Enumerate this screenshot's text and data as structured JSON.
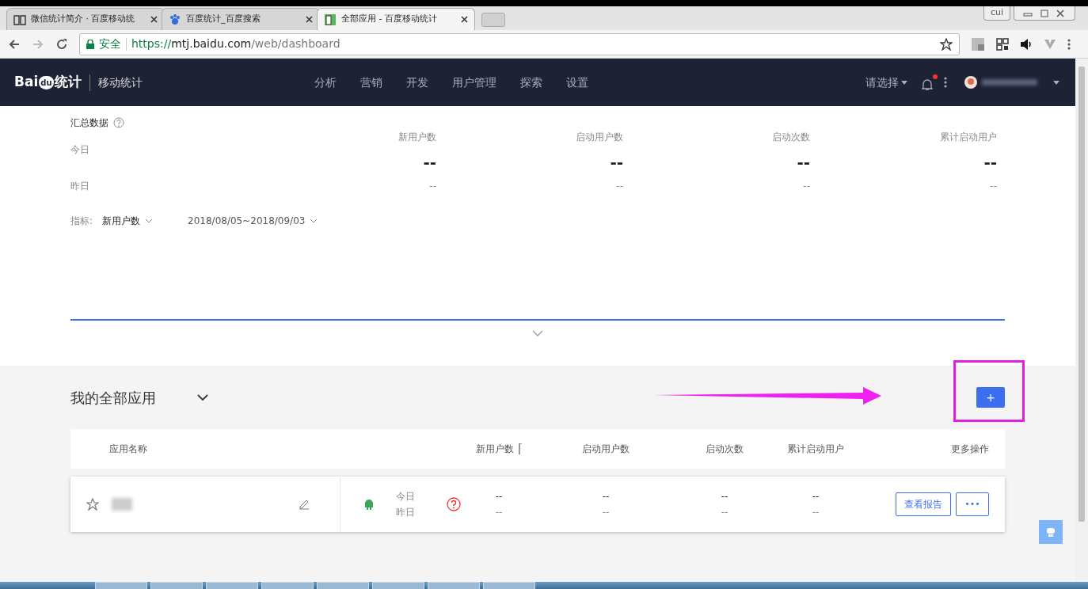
{
  "browser": {
    "tabs": [
      {
        "title": "微信统计简介 · 百度移动统",
        "selected": false
      },
      {
        "title": "百度统计_百度搜索",
        "selected": false
      },
      {
        "title": "全部应用 - 百度移动统计",
        "selected": true
      }
    ],
    "profile": "cui",
    "secure_label": "安全",
    "url_scheme": "https://",
    "url_host": "mtj.baidu.com",
    "url_path": "/web/dashboard"
  },
  "nav": {
    "brand_left": "Bai",
    "brand_paw": "du",
    "brand_right": "统计",
    "product": "移动统计",
    "menu": [
      "分析",
      "营销",
      "开发",
      "用户管理",
      "探索",
      "设置"
    ],
    "selector": "请选择",
    "has_unread": true
  },
  "summary": {
    "title": "汇总数据",
    "row_labels": [
      "今日",
      "昨日"
    ],
    "metrics": [
      {
        "label": "新用户数",
        "today": "--",
        "yesterday": "--"
      },
      {
        "label": "启动用户数",
        "today": "--",
        "yesterday": "--"
      },
      {
        "label": "启动次数",
        "today": "--",
        "yesterday": "--"
      },
      {
        "label": "累计启动用户",
        "today": "--",
        "yesterday": "--"
      }
    ],
    "filter": {
      "label": "指标:",
      "metric": "新用户数",
      "date_range": "2018/08/05~2018/09/03"
    }
  },
  "apps": {
    "title": "我的全部应用",
    "add_button": "+",
    "columns": [
      {
        "label": "应用名称",
        "sorted": false
      },
      {
        "label": "新用户数",
        "sorted": true
      },
      {
        "label": "启动用户数",
        "sorted": false
      },
      {
        "label": "启动次数",
        "sorted": false
      },
      {
        "label": "累计启动用户",
        "sorted": false
      },
      {
        "label": "更多操作",
        "sorted": false
      }
    ],
    "rows": [
      {
        "starred": false,
        "day_labels": [
          "今日",
          "昨日"
        ],
        "values": [
          {
            "today": "--",
            "yesterday": "--"
          },
          {
            "today": "--",
            "yesterday": "--"
          },
          {
            "today": "--",
            "yesterday": "--"
          },
          {
            "today": "--",
            "yesterday": "--"
          }
        ],
        "report_button": "查看报告",
        "more_button": "•••"
      }
    ]
  }
}
